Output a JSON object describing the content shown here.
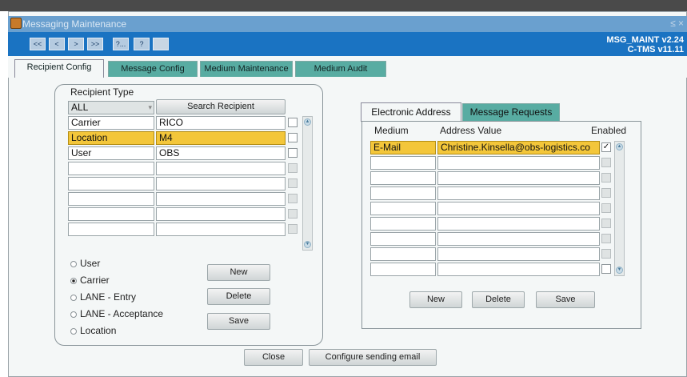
{
  "window": {
    "title": "Messaging Maintenance",
    "controls": "≤ ×"
  },
  "toolbar": {
    "buttons": [
      "<<",
      "<",
      ">",
      ">>",
      "?...",
      "?",
      ""
    ],
    "app_id": "MSG_MAINT v2.24",
    "version": "C-TMS v11.11"
  },
  "tabs": [
    "Recipient Config",
    "Message Config",
    "Medium Maintenance",
    "Medium Audit"
  ],
  "recipient": {
    "type_label": "Recipient Type",
    "type_select": "ALL",
    "search_button": "Search Recipient",
    "rows": [
      {
        "type": "Carrier",
        "value": "RICO"
      },
      {
        "type": "Location",
        "value": "M4"
      },
      {
        "type": "User",
        "value": "OBS"
      },
      {
        "type": "",
        "value": ""
      },
      {
        "type": "",
        "value": ""
      },
      {
        "type": "",
        "value": ""
      },
      {
        "type": "",
        "value": ""
      },
      {
        "type": "",
        "value": ""
      }
    ],
    "radios": [
      "User",
      "Carrier",
      "LANE - Entry",
      "LANE - Acceptance",
      "Location"
    ],
    "radio_selected": "Carrier",
    "buttons": {
      "new": "New",
      "delete": "Delete",
      "save": "Save"
    }
  },
  "address": {
    "tabs": [
      "Electronic Address",
      "Message Requests"
    ],
    "col_medium": "Medium",
    "col_value": "Address Value",
    "col_enabled": "Enabled",
    "rows": [
      {
        "medium": "E-Mail",
        "value": "Christine.Kinsella@obs-logistics.co",
        "enabled": true
      }
    ],
    "buttons": {
      "new": "New",
      "delete": "Delete",
      "save": "Save"
    }
  },
  "footer": {
    "close": "Close",
    "configure": "Configure sending email"
  },
  "colors": {
    "toolbar": "#1a73c2",
    "selected_row": "#f3c63a",
    "tab": "#58aca2"
  }
}
